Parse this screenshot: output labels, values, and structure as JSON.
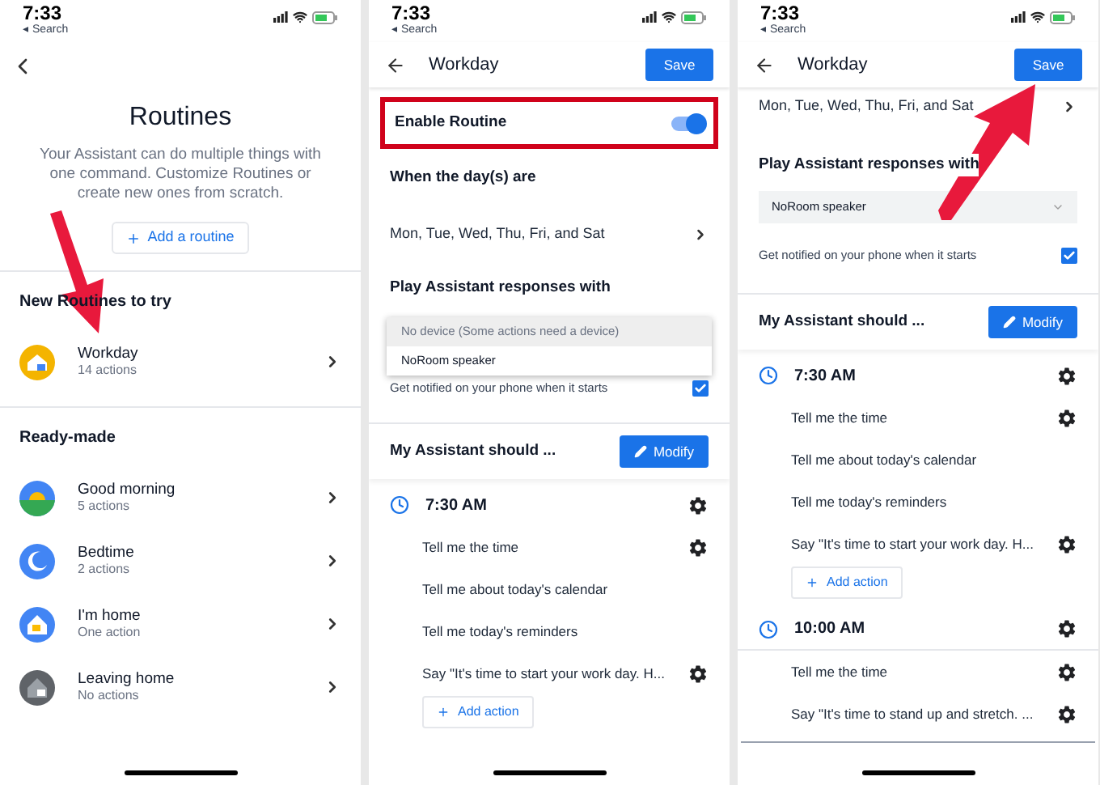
{
  "screens": [
    {
      "kind": "list",
      "annotations": [
        {
          "kind": "arrow_down"
        }
      ],
      "status": {
        "time": "7:33",
        "back_label": "◂ Search"
      },
      "title": "Routines",
      "description": "Your Assistant can do multiple things with one command. Customize Routines or create new ones from scratch.",
      "add_button": "Add a routine",
      "sections": [
        {
          "heading": "New Routines to try",
          "items": [
            {
              "name": "Workday",
              "subtitle": "14 actions",
              "kind": "work"
            }
          ]
        },
        {
          "heading": "Ready-made",
          "items": [
            {
              "name": "Good morning",
              "subtitle": "5 actions",
              "kind": "sunrise"
            },
            {
              "name": "Bedtime",
              "subtitle": "2 actions",
              "kind": "moon"
            },
            {
              "name": "I'm home",
              "subtitle": "One action",
              "kind": "home"
            },
            {
              "name": "Leaving home",
              "subtitle": "No actions",
              "kind": "leaving"
            }
          ]
        }
      ]
    },
    {
      "kind": "editor",
      "status": {
        "time": "7:33",
        "back_label": "◂ Search"
      },
      "header": {
        "title": "Workday",
        "save": "Save"
      },
      "enable": {
        "label": "Enable Routine",
        "on": true,
        "highlighted": true
      },
      "when_heading": "When the day(s) are",
      "days": "Mon, Tue, Wed, Thu, Fri, and Sat",
      "play_heading": "Play Assistant responses with",
      "device": {
        "open": true,
        "options": [
          {
            "label": "No device (Some actions need a device)",
            "selected": false
          },
          {
            "label": "NoRoom speaker",
            "selected": true
          }
        ]
      },
      "notify": {
        "label": "Get notified on your phone when it starts",
        "checked": true
      },
      "assistant": {
        "heading": "My Assistant should ...",
        "modify": "Modify"
      },
      "groups": [
        {
          "time": "7:30 AM",
          "actions": [
            {
              "label": "Tell me the time",
              "settings": true
            },
            {
              "label": "Tell me about today's calendar",
              "settings": false
            },
            {
              "label": "Tell me today's reminders",
              "settings": false
            },
            {
              "label": "Say \"It's time to start your work day. H...",
              "settings": true
            }
          ],
          "add_action": "Add action"
        }
      ]
    },
    {
      "kind": "editor",
      "annotations": [
        {
          "kind": "arrow_up"
        }
      ],
      "status": {
        "time": "7:33",
        "back_label": "◂ Search"
      },
      "header": {
        "title": "Workday",
        "save": "Save"
      },
      "days": "Mon, Tue, Wed, Thu, Fri, and Sat",
      "play_heading": "Play Assistant responses with",
      "device": {
        "open": false,
        "value": "NoRoom speaker"
      },
      "notify": {
        "label": "Get notified on your phone when it starts",
        "checked": true
      },
      "assistant": {
        "heading": "My Assistant should ...",
        "modify": "Modify"
      },
      "groups": [
        {
          "time": "7:30 AM",
          "actions": [
            {
              "label": "Tell me the time",
              "settings": true
            },
            {
              "label": "Tell me about today's calendar",
              "settings": false
            },
            {
              "label": "Tell me today's reminders",
              "settings": false
            },
            {
              "label": "Say \"It's time to start your work day. H...",
              "settings": true
            }
          ],
          "add_action": "Add action"
        },
        {
          "time": "10:00 AM",
          "actions": [
            {
              "label": "Tell me the time",
              "settings": true
            },
            {
              "label": "Say \"It's time to stand up and stretch. ...",
              "settings": true
            }
          ]
        }
      ]
    }
  ]
}
